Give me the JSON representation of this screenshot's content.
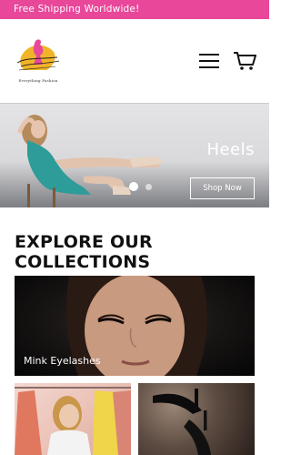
{
  "promo": {
    "text": "Free Shipping Worldwide!"
  },
  "header": {
    "logo_tagline": "Everything Fashion",
    "icons": {
      "menu": "hamburger-menu-icon",
      "cart": "shopping-cart-icon"
    }
  },
  "hero": {
    "title": "Heels",
    "cta_label": "Shop Now",
    "slides": {
      "active": 1,
      "count": 2
    }
  },
  "collections": {
    "title": "EXPLORE OUR COLLECTIONS",
    "items": [
      {
        "label": "Mink Eyelashes"
      },
      {
        "label": ""
      },
      {
        "label": ""
      }
    ]
  },
  "colors": {
    "promo_bg": "#e8479a",
    "logo_pink": "#e8479a",
    "logo_gold": "#f0b429"
  }
}
